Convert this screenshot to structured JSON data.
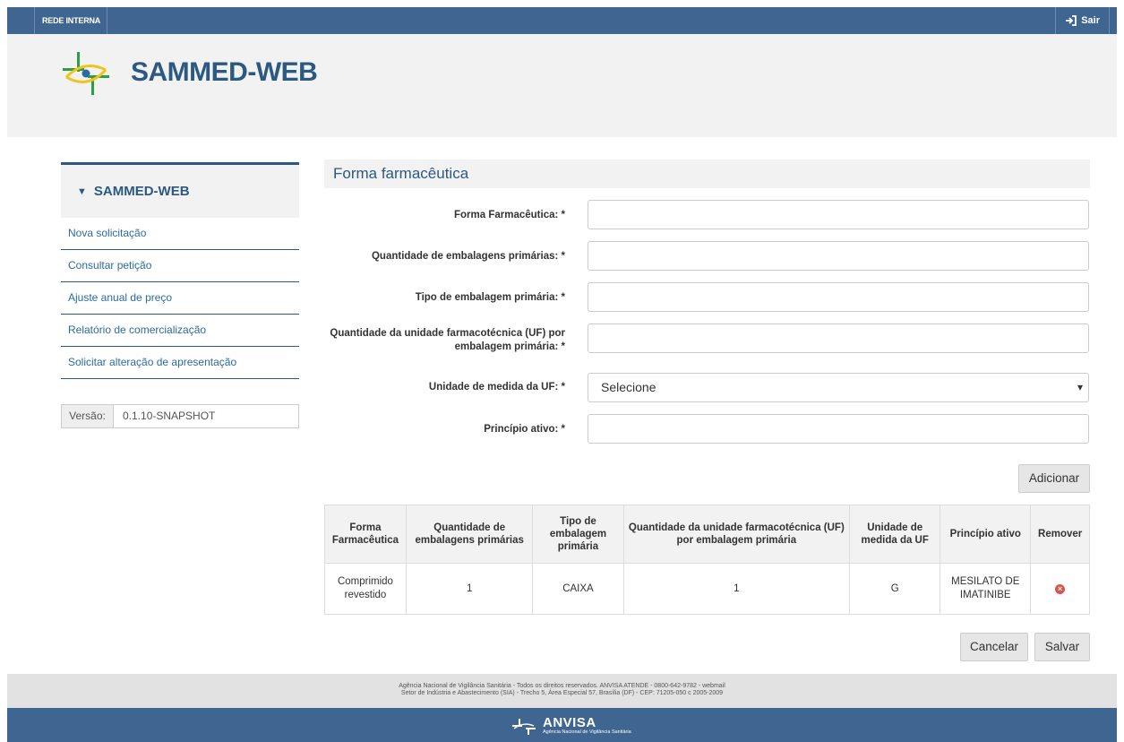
{
  "topbar": {
    "rede_label": "REDE INTERNA",
    "sair_label": "Sair",
    "sair_icon": "logout-icon"
  },
  "header": {
    "brand": "SAMMED-WEB"
  },
  "sidebar": {
    "title": "SAMMED-WEB",
    "items": [
      {
        "label": "Nova solicitação"
      },
      {
        "label": "Consultar petição"
      },
      {
        "label": "Ajuste anual de preço"
      },
      {
        "label": "Relatório de comercialização"
      },
      {
        "label": "Solicitar alteração de apresentação"
      }
    ],
    "version_label": "Versão:",
    "version_value": "0.1.10-SNAPSHOT"
  },
  "form": {
    "title": "Forma farmacêutica",
    "fields": [
      {
        "label": "Forma Farmacêutica: *",
        "value": ""
      },
      {
        "label": "Quantidade de embalagens primárias: *",
        "value": ""
      },
      {
        "label": "Tipo de embalagem primária: *",
        "value": ""
      },
      {
        "label": "Quantidade da unidade farmacotécnica (UF) por embalagem primária: *",
        "value": ""
      },
      {
        "label": "Unidade de medida da UF: *",
        "value": "Selecione"
      },
      {
        "label": "Princípio ativo: *",
        "value": ""
      }
    ],
    "add_label": "Adicionar"
  },
  "table": {
    "headers": [
      "Forma Farmacêutica",
      "Quantidade de embalagens primárias",
      "Tipo de embalagem primária",
      "Quantidade da unidade farmacotécnica (UF) por embalagem primária",
      "Unidade de medida da UF",
      "Princípio ativo",
      "Remover"
    ],
    "rows": [
      [
        "Comprimido revestido",
        "1",
        "CAIXA",
        "1",
        "G",
        "MESILATO DE IMATINIBE"
      ]
    ]
  },
  "actions": {
    "cancel_label": "Cancelar",
    "save_label": "Salvar"
  },
  "footer": {
    "line1": "Agência Nacional de Vigilância Sanitária - Todos os direitos reservados. ANVISA ATENDE - 0800-642-9782 - webmail",
    "line2": "Setor de Indústria e Abastecimento (SIA) - Trecho 5, Área Especial 57, Brasília (DF) - CEP: 71205-050 c 2005-2009",
    "anvisa_title": "ANVISA",
    "anvisa_sub": "Agência Nacional de Vigilância Sanitária"
  },
  "colors": {
    "primary": "#3f6690",
    "brand_text": "#2c5982",
    "link": "#2c6aa0",
    "remove": "#d9534f"
  }
}
